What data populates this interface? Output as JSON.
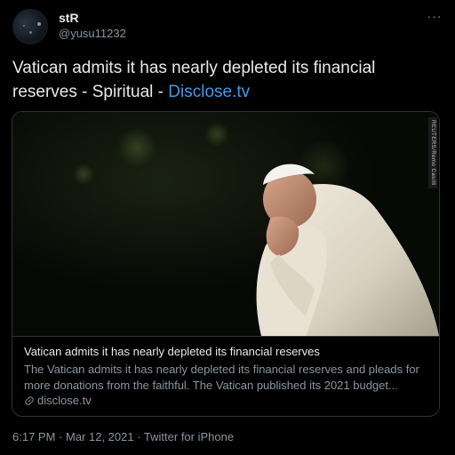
{
  "author": {
    "display_name": "stR",
    "handle": "@yusu11232",
    "avatar_icon": "starry-sky-avatar"
  },
  "more_icon": "more-horizontal-icon",
  "more_label": "···",
  "tweet": {
    "text": "Vatican admits it has nearly depleted its financial reserves - Spiritual - ",
    "link_text": "Disclose.tv"
  },
  "card": {
    "image_alt": "Pope Francis praying with hand on face against a dark background",
    "photo_credit": "REUTERS/Remo Casilli",
    "title": "Vatican admits it has nearly depleted its financial reserves",
    "description": "The Vatican admits it has nearly depleted its financial reserves and pleads for more donations from the faithful. The Vatican published its 2021 budget...",
    "domain": "disclose.tv",
    "domain_icon": "link-icon"
  },
  "meta": {
    "time": "6:17 PM",
    "separator": " · ",
    "date": "Mar 12, 2021",
    "source": "Twitter for iPhone"
  },
  "colors": {
    "background": "#000000",
    "link": "#3b9cf0",
    "secondary_text": "#8b949e",
    "border": "#2f3336"
  }
}
